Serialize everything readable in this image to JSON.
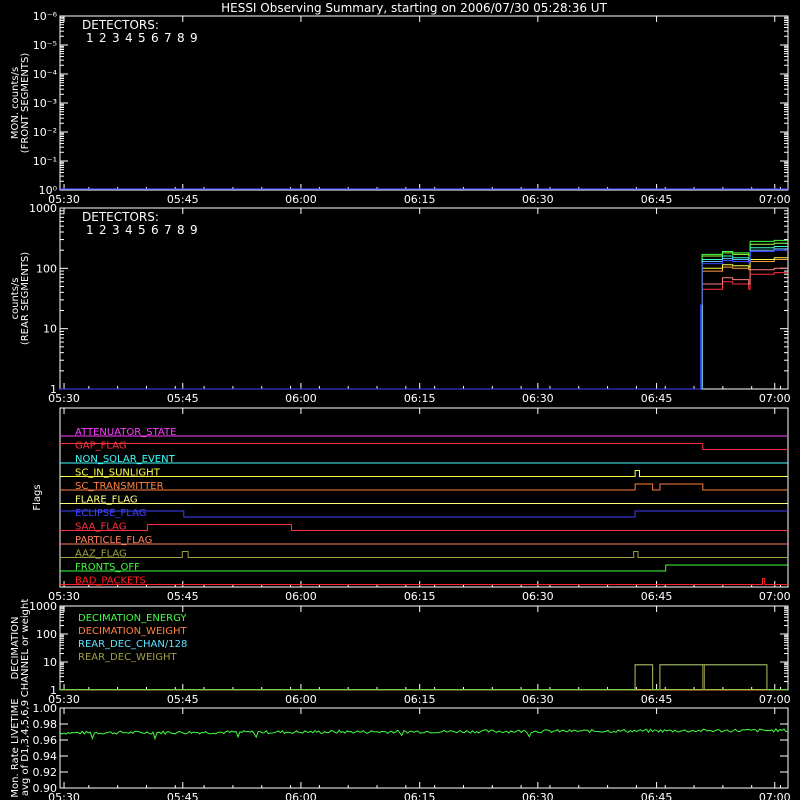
{
  "title": "HESSI Observing Summary, starting on 2006/07/30 05:28:36 UT",
  "time_ticks": [
    "05:30",
    "05:45",
    "06:00",
    "06:15",
    "06:30",
    "06:45",
    "07:00"
  ],
  "colors": {
    "axes": "#ffffff",
    "det": [
      "#ff3040",
      "#ff8080",
      "#ffa040",
      "#ffff40",
      "#a0ff40",
      "#40ff40",
      "#40ffc0",
      "#60c0ff",
      "#4040ff"
    ]
  },
  "chart_data": [
    {
      "id": "front",
      "type": "line",
      "ylabel_lines": [
        "MON. counts/s",
        "(FRONT SEGMENTS)"
      ],
      "yscale": "log",
      "ylim": [
        1,
        1000000
      ],
      "ytick_labels": [
        "10⁰",
        "10⁻¹",
        "10⁻²",
        "10⁻³",
        "10⁻⁴",
        "10⁻⁵",
        "10⁻⁶",
        "10⁻³",
        "10⁻⁸"
      ],
      "legend_title": "DETECTORS:",
      "legend_items": [
        "1",
        "2",
        "3",
        "4",
        "5",
        "6",
        "7",
        "8",
        "9"
      ],
      "series": [
        {
          "values": [
            [
              0,
              1
            ],
            [
              100,
              1
            ]
          ]
        }
      ]
    },
    {
      "id": "rear",
      "type": "line",
      "ylabel_lines": [
        "counts/s",
        "(REAR SEGMENTS)"
      ],
      "yscale": "log",
      "ylim": [
        1,
        1000
      ],
      "ytick_labels": [
        "1",
        "10",
        "100",
        "1000"
      ],
      "legend_title": "DETECTORS:",
      "legend_items": [
        "1",
        "2",
        "3",
        "4",
        "5",
        "6",
        "7",
        "8",
        "9"
      ],
      "series": [
        {
          "values": [
            [
              0,
              1
            ],
            [
              88.0,
              1
            ],
            [
              88.2,
              45
            ],
            [
              90.5,
              45
            ],
            [
              91.0,
              60
            ],
            [
              92.4,
              55
            ],
            [
              94.6,
              45
            ],
            [
              94.8,
              80
            ],
            [
              96.2,
              80
            ],
            [
              98.1,
              85
            ],
            [
              100,
              85
            ]
          ]
        },
        {
          "values": [
            [
              0,
              1
            ],
            [
              88.0,
              1
            ],
            [
              88.2,
              55
            ],
            [
              90.5,
              55
            ],
            [
              91.0,
              70
            ],
            [
              92.4,
              65
            ],
            [
              94.6,
              55
            ],
            [
              94.8,
              95
            ],
            [
              96.2,
              95
            ],
            [
              98.1,
              100
            ],
            [
              100,
              100
            ]
          ]
        },
        {
          "values": [
            [
              0,
              1
            ],
            [
              88.0,
              1
            ],
            [
              88.2,
              90
            ],
            [
              90.5,
              90
            ],
            [
              91.0,
              105
            ],
            [
              92.4,
              100
            ],
            [
              94.6,
              95
            ],
            [
              94.8,
              130
            ],
            [
              96.2,
              130
            ],
            [
              98.1,
              140
            ],
            [
              100,
              140
            ]
          ]
        },
        {
          "values": [
            [
              0,
              1
            ],
            [
              88.0,
              1
            ],
            [
              88.2,
              100
            ],
            [
              90.5,
              100
            ],
            [
              91.0,
              115
            ],
            [
              92.4,
              110
            ],
            [
              94.6,
              105
            ],
            [
              94.8,
              140
            ],
            [
              96.2,
              140
            ],
            [
              98.1,
              150
            ],
            [
              100,
              150
            ]
          ]
        },
        {
          "values": [
            [
              0,
              1
            ],
            [
              88.0,
              1
            ],
            [
              88.2,
              160
            ],
            [
              90.5,
              160
            ],
            [
              91.0,
              180
            ],
            [
              92.4,
              170
            ],
            [
              94.6,
              160
            ],
            [
              94.8,
              250
            ],
            [
              96.2,
              250
            ],
            [
              98.1,
              260
            ],
            [
              100,
              260
            ]
          ]
        },
        {
          "values": [
            [
              0,
              1
            ],
            [
              88.0,
              1
            ],
            [
              88.2,
              170
            ],
            [
              90.5,
              170
            ],
            [
              91.0,
              190
            ],
            [
              92.4,
              180
            ],
            [
              94.6,
              170
            ],
            [
              94.8,
              280
            ],
            [
              96.2,
              280
            ],
            [
              98.1,
              290
            ],
            [
              100,
              290
            ]
          ]
        },
        {
          "values": [
            [
              0,
              1
            ],
            [
              88.0,
              1
            ],
            [
              88.2,
              140
            ],
            [
              90.5,
              140
            ],
            [
              91.0,
              160
            ],
            [
              92.4,
              150
            ],
            [
              94.6,
              145
            ],
            [
              94.8,
              220
            ],
            [
              96.2,
              220
            ],
            [
              98.1,
              230
            ],
            [
              100,
              230
            ]
          ]
        },
        {
          "values": [
            [
              0,
              1
            ],
            [
              88.0,
              1
            ],
            [
              88.2,
              130
            ],
            [
              90.5,
              130
            ],
            [
              91.0,
              145
            ],
            [
              92.4,
              140
            ],
            [
              94.6,
              135
            ],
            [
              94.8,
              200
            ],
            [
              96.2,
              200
            ],
            [
              98.1,
              210
            ],
            [
              100,
              210
            ]
          ]
        },
        {
          "values": [
            [
              0,
              1
            ],
            [
              87.9,
              1
            ],
            [
              88.0,
              25
            ],
            [
              88.1,
              25
            ],
            [
              88.2,
              120
            ],
            [
              90.5,
              120
            ],
            [
              91.0,
              135
            ],
            [
              92.4,
              130
            ],
            [
              94.6,
              125
            ],
            [
              94.8,
              190
            ],
            [
              96.2,
              190
            ],
            [
              98.1,
              200
            ],
            [
              100,
              200
            ]
          ]
        }
      ]
    },
    {
      "id": "flags",
      "type": "line",
      "ylabel": "Flags",
      "flags": [
        {
          "name": "ATTENUATOR_STATE",
          "color": "#ff40ff",
          "segments": [
            [
              0,
              100,
              0
            ]
          ]
        },
        {
          "name": "GAP_FLAG",
          "color": "#ff3040",
          "segments": [
            [
              0,
              88.3,
              1
            ],
            [
              88.3,
              100,
              0
            ]
          ]
        },
        {
          "name": "NON_SOLAR_EVENT",
          "color": "#40ffff",
          "segments": [
            [
              0,
              100,
              0
            ]
          ]
        },
        {
          "name": "SC_IN_SUNLIGHT",
          "color": "#ffff40",
          "segments": [
            [
              0,
              79.0,
              0
            ],
            [
              79.0,
              79.6,
              1
            ],
            [
              79.6,
              100,
              0
            ]
          ]
        },
        {
          "name": "SC_TRANSMITTER",
          "color": "#ff8040",
          "segments": [
            [
              0,
              79.0,
              0
            ],
            [
              79.0,
              81.4,
              1
            ],
            [
              81.4,
              82.4,
              0
            ],
            [
              82.4,
              88.3,
              1
            ],
            [
              88.3,
              100,
              0
            ]
          ]
        },
        {
          "name": "FLARE_FLAG",
          "color": "#ffff80",
          "segments": [
            [
              0,
              100,
              0
            ]
          ]
        },
        {
          "name": "ECLIPSE_FLAG",
          "color": "#4040ff",
          "segments": [
            [
              0,
              17.0,
              1
            ],
            [
              17.0,
              79.0,
              0
            ],
            [
              79.0,
              100,
              1
            ]
          ]
        },
        {
          "name": "SAA_FLAG",
          "color": "#ff3040",
          "segments": [
            [
              0,
              12.0,
              0
            ],
            [
              12.0,
              31.8,
              1
            ],
            [
              31.8,
              100,
              0
            ]
          ]
        },
        {
          "name": "PARTICLE_FLAG",
          "color": "#ff8060",
          "segments": [
            [
              0,
              100,
              0
            ]
          ]
        },
        {
          "name": "AAZ_FLAG",
          "color": "#a0a040",
          "segments": [
            [
              0,
              16.8,
              0
            ],
            [
              16.8,
              17.6,
              1
            ],
            [
              17.6,
              78.8,
              0
            ],
            [
              78.8,
              79.4,
              1
            ],
            [
              79.4,
              100,
              0
            ]
          ]
        },
        {
          "name": "FRONTS_OFF",
          "color": "#40ff40",
          "segments": [
            [
              0,
              83.2,
              0
            ],
            [
              83.2,
              100,
              1
            ]
          ]
        },
        {
          "name": "BAD_PACKETS",
          "color": "#ff2020",
          "segments": [
            [
              0,
              96.5,
              0
            ],
            [
              96.5,
              96.8,
              1
            ],
            [
              96.8,
              100,
              0
            ]
          ]
        }
      ]
    },
    {
      "id": "decimation",
      "type": "line",
      "ylabel_lines": [
        "DECIMATION",
        "CHANNEL or weight"
      ],
      "yscale": "log",
      "ylim": [
        1,
        1000
      ],
      "ytick_labels": [
        "1",
        "10",
        "100",
        "1000"
      ],
      "series": [
        {
          "name": "DECIMATION_ENERGY",
          "color": "#40ff40",
          "values": [
            [
              0,
              1
            ],
            [
              100,
              1
            ]
          ]
        },
        {
          "name": "DECIMATION_WEIGHT",
          "color": "#ff8040",
          "values": [
            [
              0,
              1
            ],
            [
              100,
              1
            ]
          ]
        },
        {
          "name": "REAR_DEC_CHAN/128",
          "color": "#60e0ff",
          "values": [
            [
              0,
              1
            ],
            [
              79.0,
              1
            ],
            [
              79.0,
              8
            ],
            [
              81.4,
              8
            ],
            [
              81.4,
              1
            ],
            [
              82.4,
              1
            ],
            [
              82.4,
              8
            ],
            [
              97.1,
              8
            ],
            [
              97.1,
              1
            ],
            [
              100,
              1
            ]
          ]
        },
        {
          "name": "REAR_DEC_WEIGHT",
          "color": "#a0a040",
          "values": [
            [
              0,
              1
            ],
            [
              79.0,
              1
            ],
            [
              79.0,
              8
            ],
            [
              81.4,
              8
            ],
            [
              81.4,
              1
            ],
            [
              82.4,
              1
            ],
            [
              82.4,
              8
            ],
            [
              88.3,
              8
            ],
            [
              88.3,
              1
            ],
            [
              88.5,
              1
            ],
            [
              88.5,
              8
            ],
            [
              97.1,
              8
            ],
            [
              97.1,
              1
            ],
            [
              100,
              1
            ]
          ]
        }
      ]
    },
    {
      "id": "livetime",
      "type": "line",
      "ylabel_lines": [
        "Mon. Rate LIVETIME",
        "avg of D1,3,4,5,6,9"
      ],
      "ylim": [
        0.9,
        1.0
      ],
      "ytick_labels": [
        "0.90",
        "0.92",
        "0.94",
        "0.96",
        "0.98",
        "1.00"
      ],
      "series": [
        {
          "color": "#40ff40",
          "mean": 0.969,
          "slope": 0.003
        }
      ]
    }
  ]
}
